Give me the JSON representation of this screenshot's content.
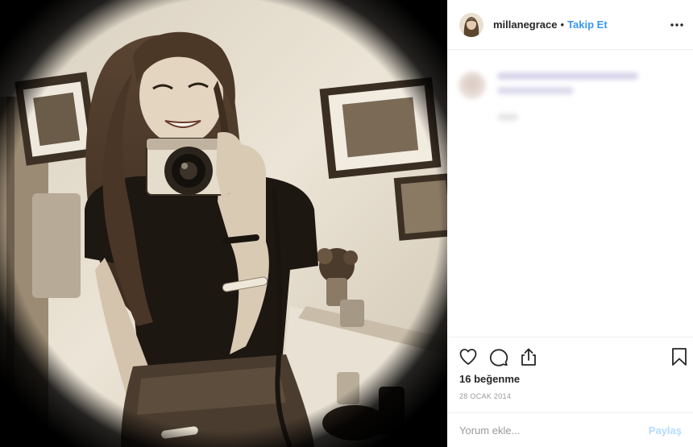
{
  "post": {
    "photo_alt": "Sepia mirror selfie with camera",
    "header": {
      "username": "millanegrace",
      "separator": "•",
      "follow_label": "Takip Et",
      "more_icon": "more-options-icon"
    },
    "actions": {
      "like_icon": "heart-icon",
      "comment_icon": "comment-icon",
      "share_icon": "share-icon",
      "save_icon": "bookmark-icon"
    },
    "likes_text": "16 beğenme",
    "date_text": "28 OCAK 2014",
    "comment_box": {
      "placeholder": "Yorum ekle...",
      "post_label": "Paylaş"
    }
  },
  "colors": {
    "accent": "#3897f0",
    "post_disabled": "#b3dbff",
    "text": "#262626",
    "muted": "#999999",
    "divider": "#efefef",
    "sepia_light": "#e6dccc",
    "sepia_dark": "#2a2118"
  }
}
